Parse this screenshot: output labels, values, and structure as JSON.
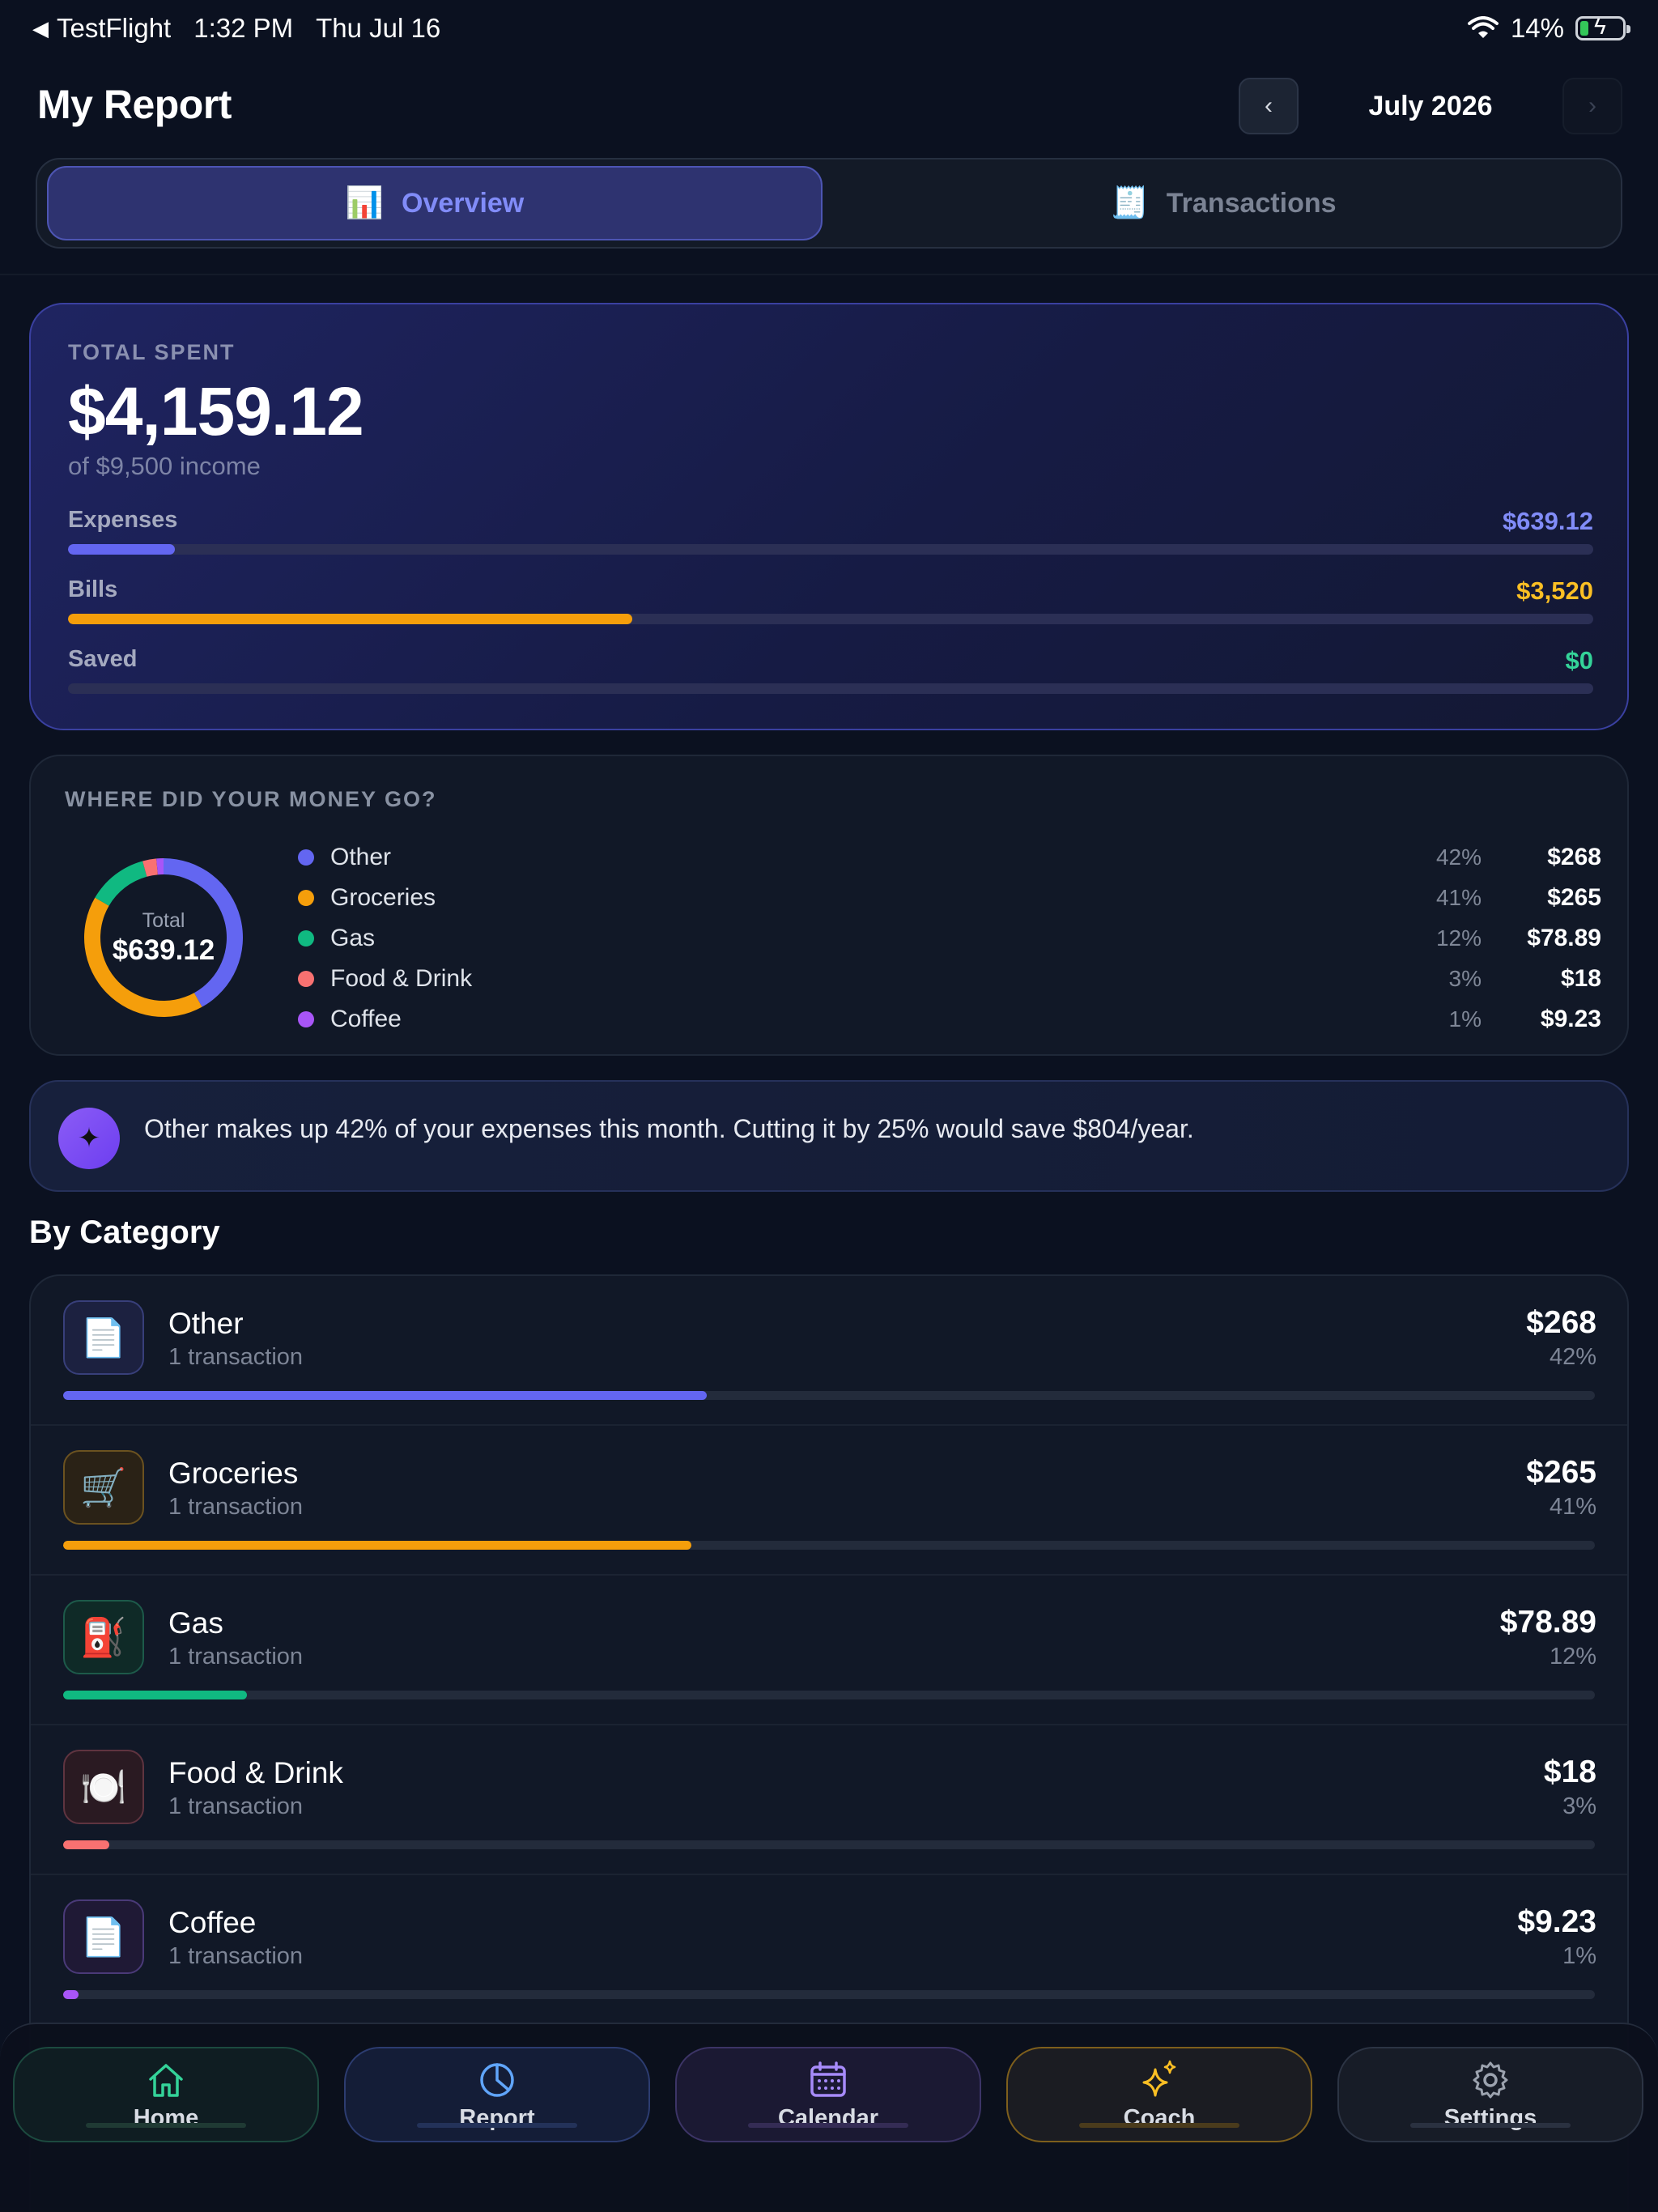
{
  "status_bar": {
    "back_app": "TestFlight",
    "time": "1:32 PM",
    "date": "Thu Jul 16",
    "battery": "14%"
  },
  "header": {
    "title": "My Report",
    "prev_label": "‹",
    "month": "July 2026",
    "next_label": "›"
  },
  "tabs": {
    "overview": {
      "emoji": "📊",
      "label": "Overview"
    },
    "transactions": {
      "emoji": "🧾",
      "label": "Transactions"
    }
  },
  "summary": {
    "label": "TOTAL SPENT",
    "amount": "$4,159.12",
    "income": "of $9,500 income",
    "rows": [
      {
        "label": "Expenses",
        "value": "$639.12",
        "color": "#818cf8",
        "bar_color": "#6366f1",
        "fraction": 0.07
      },
      {
        "label": "Bills",
        "value": "$3,520",
        "color": "#fbbf24",
        "bar_color": "#f59e0b",
        "fraction": 0.37
      },
      {
        "label": "Saved",
        "value": "$0",
        "color": "#34d399",
        "bar_color": "#10b981",
        "fraction": 0.0
      }
    ]
  },
  "breakdown": {
    "title": "WHERE DID YOUR MONEY GO?",
    "center_label": "Total",
    "center_value": "$639.12",
    "items": [
      {
        "name": "Other",
        "pct": "42%",
        "amount": "$268",
        "color": "#6366f1"
      },
      {
        "name": "Groceries",
        "pct": "41%",
        "amount": "$265",
        "color": "#f59e0b"
      },
      {
        "name": "Gas",
        "pct": "12%",
        "amount": "$78.89",
        "color": "#10b981"
      },
      {
        "name": "Food & Drink",
        "pct": "3%",
        "amount": "$18",
        "color": "#f87171"
      },
      {
        "name": "Coffee",
        "pct": "1%",
        "amount": "$9.23",
        "color": "#a855f7"
      }
    ]
  },
  "chart_data": {
    "type": "pie",
    "categories": [
      "Other",
      "Groceries",
      "Gas",
      "Food & Drink",
      "Coffee"
    ],
    "values": [
      268,
      265,
      78.89,
      18,
      9.23
    ],
    "colors": [
      "#6366f1",
      "#f59e0b",
      "#10b981",
      "#f87171",
      "#a855f7"
    ]
  },
  "insight": {
    "icon": "sparkle-icon",
    "glyph": "✦",
    "text": "Other makes up 42% of your expenses this month. Cutting it by 25% would save $804/year."
  },
  "by_category": {
    "title": "By Category",
    "rows": [
      {
        "name": "Other",
        "sub": "1 transaction",
        "amount": "$268",
        "pct": "42%",
        "fraction": 0.42,
        "icon": "📄",
        "icon_name": "document-icon",
        "color": "#6366f1",
        "icon_bg": "#1c2140",
        "icon_border": "#383f7a"
      },
      {
        "name": "Groceries",
        "sub": "1 transaction",
        "amount": "$265",
        "pct": "41%",
        "fraction": 0.41,
        "icon": "🛒",
        "icon_name": "cart-icon",
        "color": "#f59e0b",
        "icon_bg": "#2a2216",
        "icon_border": "#6b5220"
      },
      {
        "name": "Gas",
        "sub": "1 transaction",
        "amount": "$78.89",
        "pct": "12%",
        "fraction": 0.12,
        "icon": "⛽",
        "icon_name": "fuel-pump-icon",
        "color": "#10b981",
        "icon_bg": "#0f2a27",
        "icon_border": "#1d5a4a"
      },
      {
        "name": "Food & Drink",
        "sub": "1 transaction",
        "amount": "$18",
        "pct": "3%",
        "fraction": 0.03,
        "icon": "🍽️",
        "icon_name": "plate-icon",
        "color": "#f87171",
        "icon_bg": "#2a1a22",
        "icon_border": "#5f3440"
      },
      {
        "name": "Coffee",
        "sub": "1 transaction",
        "amount": "$9.23",
        "pct": "1%",
        "fraction": 0.01,
        "icon": "📄",
        "icon_name": "document-icon",
        "color": "#a855f7",
        "icon_bg": "#1f1935",
        "icon_border": "#4a3a78"
      }
    ]
  },
  "tab_bar": {
    "items": [
      {
        "label": "Home",
        "icon": "home-icon",
        "color": "#34d399"
      },
      {
        "label": "Report",
        "icon": "pie-chart-icon",
        "color": "#60a5fa"
      },
      {
        "label": "Calendar",
        "icon": "calendar-icon",
        "color": "#a78bfa"
      },
      {
        "label": "Coach",
        "icon": "sparkles-icon",
        "color": "#fbbf24"
      },
      {
        "label": "Settings",
        "icon": "gear-icon",
        "color": "#9ca3af"
      }
    ]
  }
}
